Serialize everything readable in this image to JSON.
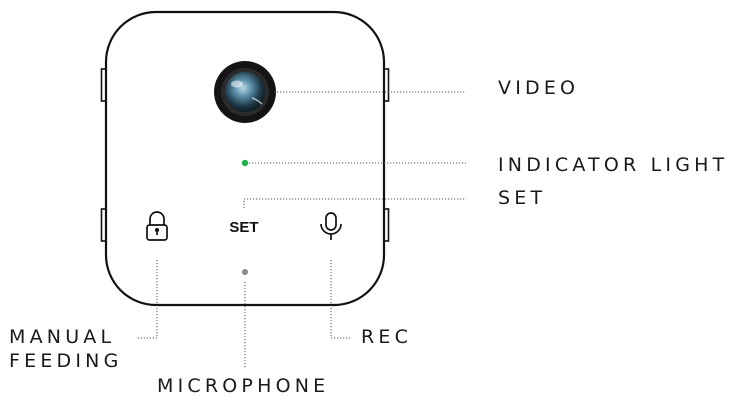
{
  "labels": {
    "video": "VIDEO",
    "indicator_light": "INDICATOR LIGHT",
    "set": "SET",
    "manual_feeding_line1": "MANUAL",
    "manual_feeding_line2": "FEEDING",
    "rec": "REC",
    "microphone": "MICROPHONE"
  },
  "device": {
    "set_button_label": "SET",
    "lock_icon": "lock-icon",
    "mic_icon": "microphone-icon",
    "camera_icon": "camera-lens-icon"
  },
  "colors": {
    "outline": "#111111",
    "leader_line": "#555555",
    "indicator_light": "#22b14c",
    "mic_hole": "#8a8a8a",
    "lens_ring": "#141414",
    "lens_glass": "#5d8ea8"
  }
}
